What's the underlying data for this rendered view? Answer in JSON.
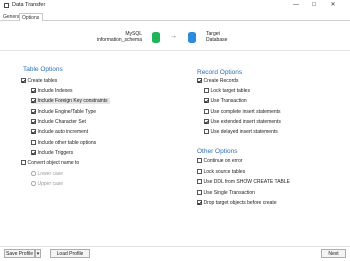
{
  "window": {
    "title": "Data Transfer",
    "controls": {
      "minimize": "—",
      "maximize": "☐",
      "close": "✕"
    }
  },
  "tabs": [
    {
      "label": "General"
    },
    {
      "label": "Options"
    }
  ],
  "header": {
    "source": {
      "line1": "MySQL",
      "line2": "information_schema"
    },
    "arrow": "→",
    "target": {
      "line1": "Target",
      "line2": "Database"
    },
    "colors": {
      "source_db": "#1fb45a",
      "target_db": "#2d8bdc"
    }
  },
  "table_options": {
    "title": "Table Options",
    "create_tables": {
      "label": "Create tables",
      "checked": true
    },
    "items": [
      {
        "label": "Include Indexes",
        "checked": true
      },
      {
        "label": "Include Foreign Key constraints",
        "checked": true
      },
      {
        "label": "Include Engine/Table Type",
        "checked": true
      },
      {
        "label": "Include Character Set",
        "checked": true
      },
      {
        "label": "Include auto increment",
        "checked": true
      },
      {
        "label": "Include other table options",
        "checked": false
      },
      {
        "label": "Include Triggers",
        "checked": true
      }
    ],
    "convert_name": {
      "label": "Convert object name to",
      "checked": false
    },
    "case_options": [
      {
        "label": "Lower case"
      },
      {
        "label": "Upper case"
      }
    ]
  },
  "record_options": {
    "title": "Record Options",
    "create_records": {
      "label": "Create Records",
      "checked": true
    },
    "items": [
      {
        "label": "Lock target tables",
        "checked": false
      },
      {
        "label": "Use Transaction",
        "checked": true
      },
      {
        "label": "Use complete insert statements",
        "checked": false
      },
      {
        "label": "Use extended insert statements",
        "checked": true
      },
      {
        "label": "Use delayed insert statements",
        "checked": false
      }
    ]
  },
  "other_options": {
    "title": "Other Options",
    "items": [
      {
        "label": "Continue on error",
        "checked": false
      },
      {
        "label": "Lock source tables",
        "checked": false
      },
      {
        "label": "Use DDL from SHOW CREATE TABLE",
        "checked": false
      },
      {
        "label": "Use Single Transaction",
        "checked": false
      },
      {
        "label": "Drop target objects before create",
        "checked": true
      }
    ]
  },
  "footer": {
    "save_profile": "Save Profile",
    "save_profile_dropdown": "▾",
    "load_profile": "Load Profile",
    "next": "Next"
  },
  "colors": {
    "section_title": "#2f6fb5"
  }
}
